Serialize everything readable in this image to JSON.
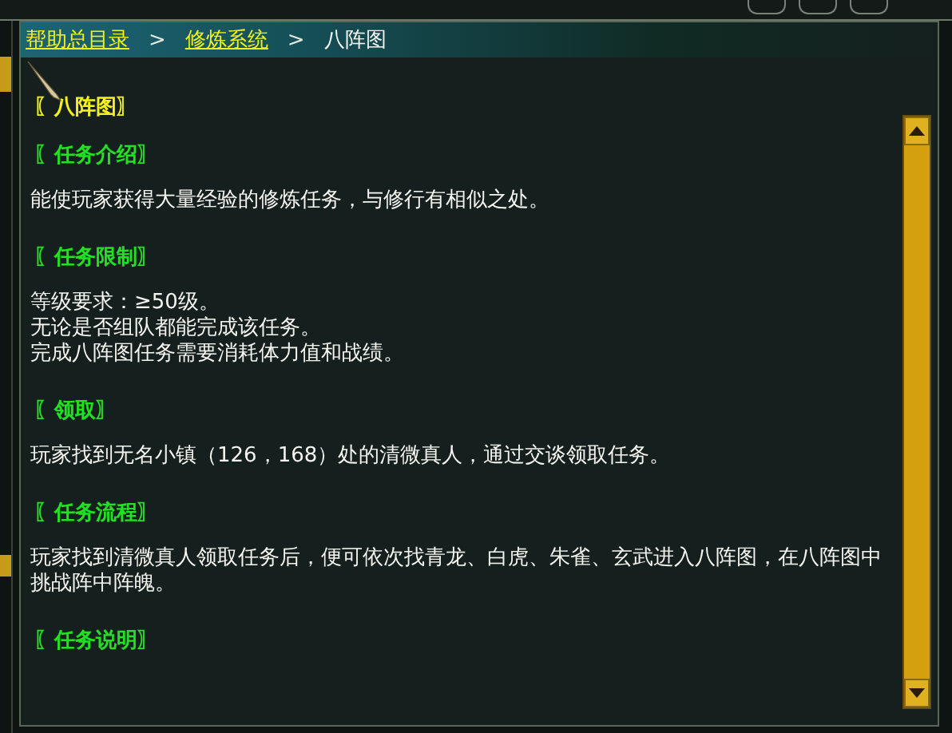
{
  "breadcrumb": [
    {
      "label": "帮助总目录",
      "kind": "link"
    },
    {
      "label": ">",
      "kind": "separator"
    },
    {
      "label": "修炼系统",
      "kind": "link"
    },
    {
      "label": ">",
      "kind": "separator"
    },
    {
      "label": "八阵图",
      "kind": "current"
    }
  ],
  "sections": [
    {
      "kind": "title",
      "heading": "〖八阵图〗"
    },
    {
      "kind": "section",
      "heading": "〖任务介绍〗",
      "paragraphs": [
        "能使玩家获得大量经验的修炼任务，与修行有相似之处。"
      ]
    },
    {
      "kind": "section",
      "heading": "〖任务限制〗",
      "paragraphs": [
        "等级要求：≥50级。",
        "无论是否组队都能完成该任务。",
        "完成八阵图任务需要消耗体力值和战绩。"
      ]
    },
    {
      "kind": "section",
      "heading": "〖领取〗",
      "paragraphs": [
        "玩家找到无名小镇（126，168）处的清微真人，通过交谈领取任务。"
      ]
    },
    {
      "kind": "section",
      "heading": "〖任务流程〗",
      "paragraphs": [
        "玩家找到清微真人领取任务后，便可依次找青龙、白虎、朱雀、玄武进入八阵图，在八阵图中挑战阵中阵魄。"
      ]
    },
    {
      "kind": "section",
      "heading": "〖任务说明〗"
    }
  ]
}
